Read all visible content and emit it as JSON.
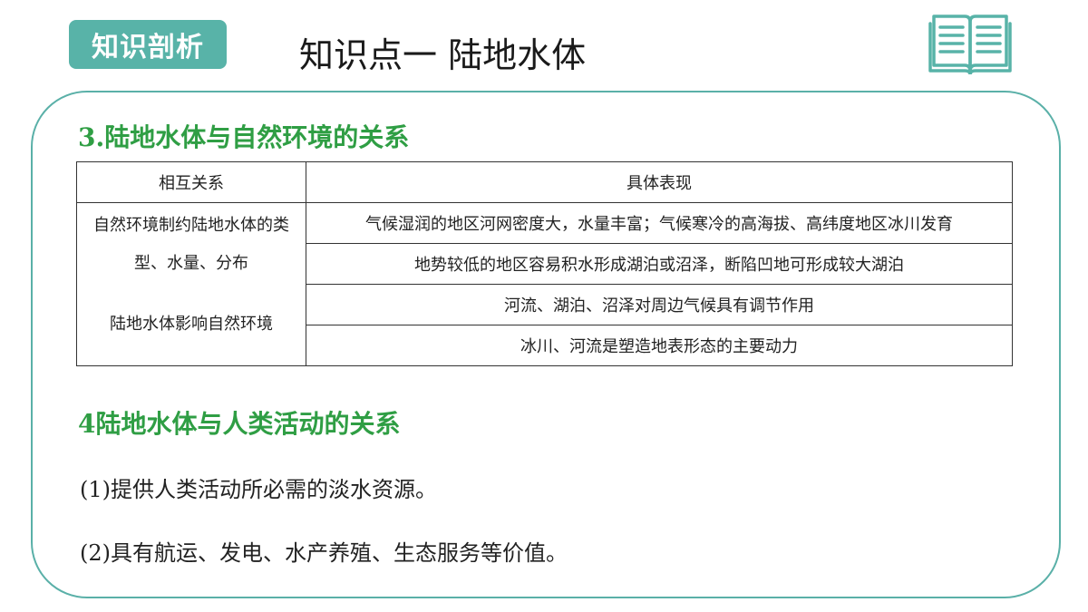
{
  "header": {
    "badge": "知识剖析",
    "title": "知识点一  陆地水体"
  },
  "icons": {
    "book": "open-book-icon",
    "accent": "#58b3a8"
  },
  "section3": {
    "title": "3.陆地水体与自然环境的关系",
    "table": {
      "headers": [
        "相互关系",
        "具体表现"
      ],
      "groups": [
        {
          "relation": "自然环境制约陆地水体的类型、水量、分布",
          "items": [
            "气候湿润的地区河网密度大，水量丰富；气候寒冷的高海拔、高纬度地区冰川发育",
            "地势较低的地区容易积水形成湖泊或沼泽，断陷凹地可形成较大湖泊"
          ]
        },
        {
          "relation": "陆地水体影响自然环境",
          "items": [
            "河流、湖泊、沼泽对周边气候具有调节作用",
            "冰川、河流是塑造地表形态的主要动力"
          ]
        }
      ]
    }
  },
  "section4": {
    "title": "4陆地水体与人类活动的关系",
    "items": [
      "(1)提供人类活动所必需的淡水资源。",
      "(2)具有航运、发电、水产养殖、生态服务等价值。"
    ]
  }
}
